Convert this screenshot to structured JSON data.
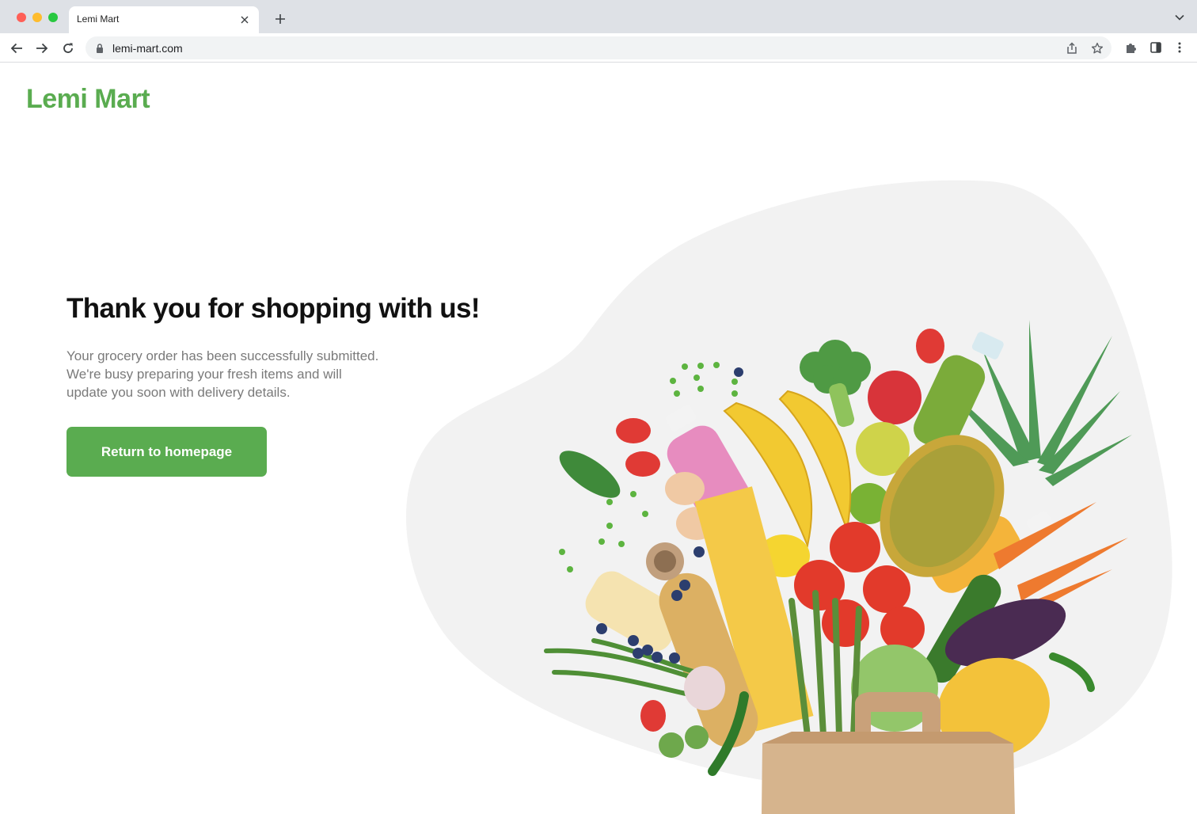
{
  "browser": {
    "tab_title": "Lemi Mart",
    "url": "lemi-mart.com"
  },
  "page": {
    "logo": "Lemi Mart",
    "headline": "Thank you for shopping with us!",
    "message_lines": [
      "Your grocery order has been successfully submitted.",
      "We're busy preparing your fresh items and will",
      "update you soon with delivery details."
    ],
    "cta_label": "Return to homepage"
  },
  "colors": {
    "brand": "#5aac50",
    "blob": "#f2f2f2",
    "headline": "#111111",
    "body_text": "#7a7a7a"
  },
  "icons": [
    "back-arrow-icon",
    "forward-arrow-icon",
    "reload-icon",
    "lock-icon",
    "share-icon",
    "star-icon",
    "puzzle-icon",
    "side-panel-icon",
    "more-icon",
    "close-icon",
    "plus-icon",
    "chevron-down-icon"
  ]
}
